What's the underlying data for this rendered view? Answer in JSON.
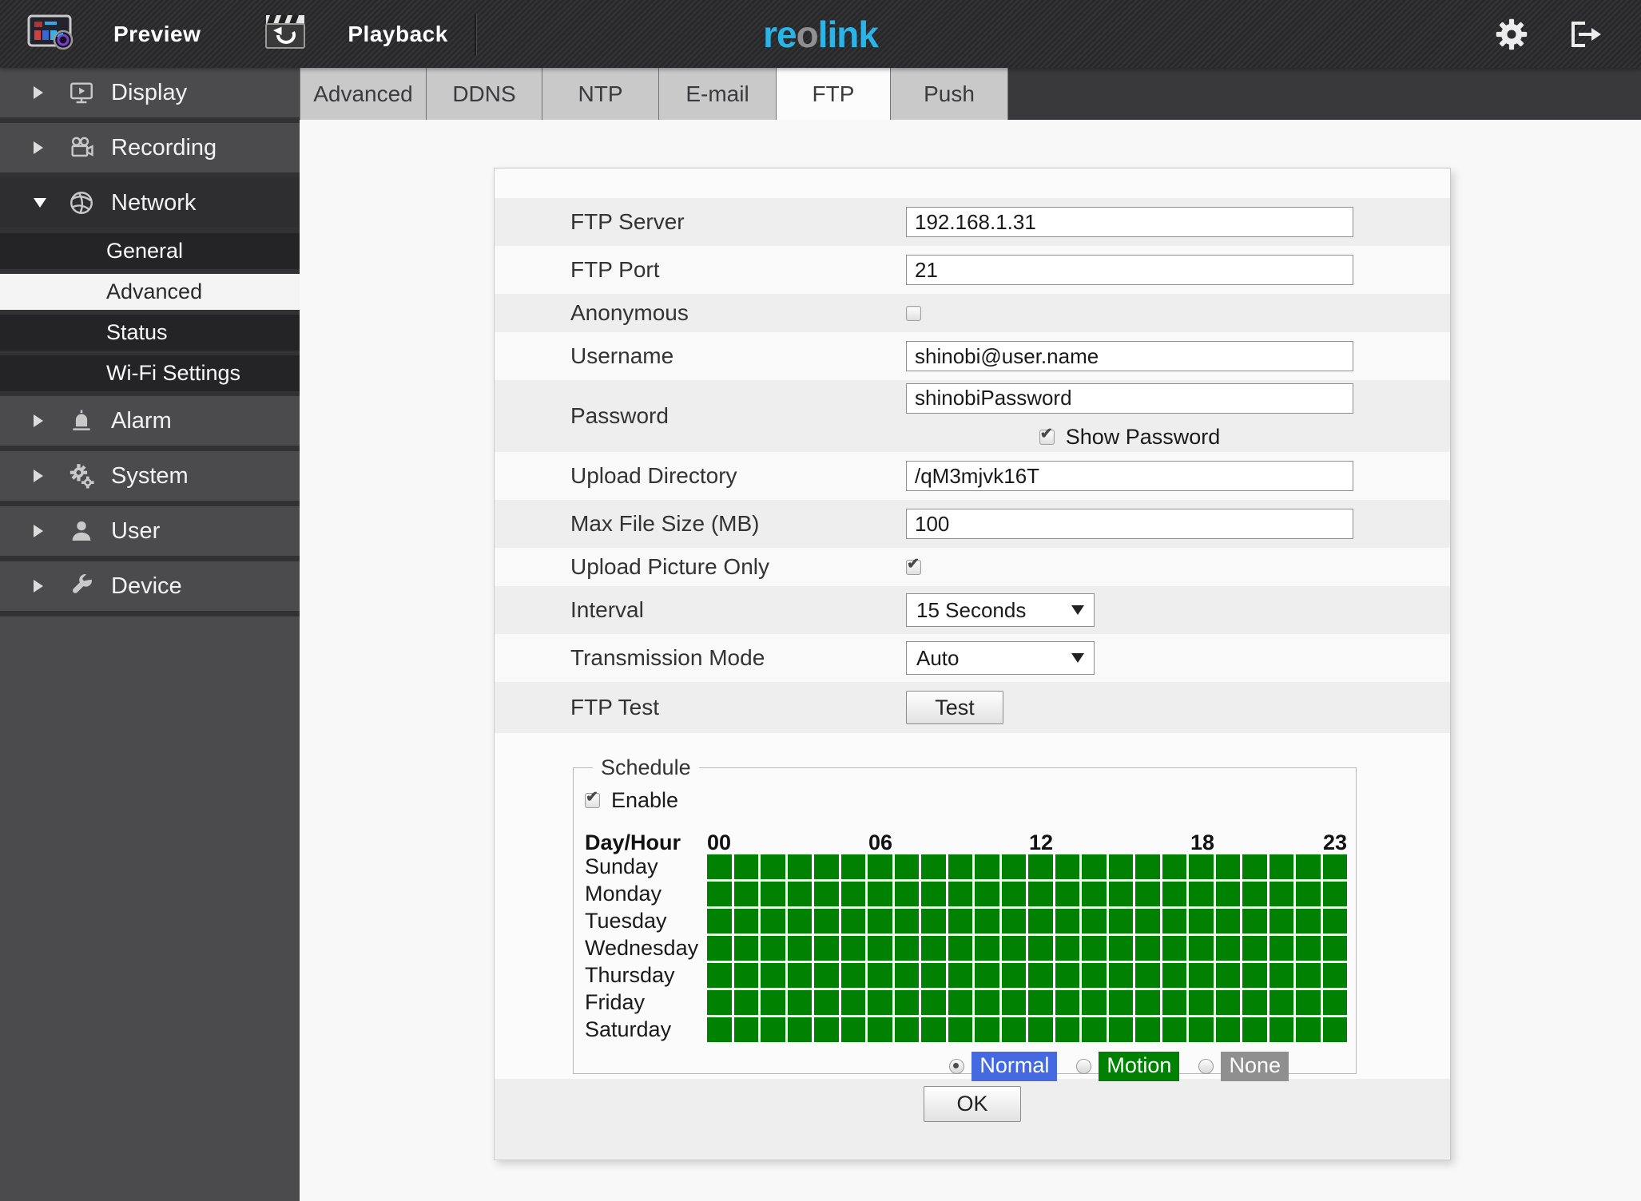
{
  "topbar": {
    "preview_label": "Preview",
    "playback_label": "Playback",
    "logo": {
      "part1": "re",
      "part2": "o",
      "part3": "link",
      "accent_color": "#2ab5e9",
      "o_color": "#8f8f8f"
    },
    "icons": {
      "settings": "gear-icon",
      "logout": "logout-icon"
    }
  },
  "sidebar": {
    "items": [
      {
        "label": "Display",
        "icon": "display-icon",
        "state": "collapsed"
      },
      {
        "label": "Recording",
        "icon": "recording-icon",
        "state": "collapsed"
      },
      {
        "label": "Network",
        "icon": "network-icon",
        "state": "expanded",
        "children": [
          {
            "label": "General",
            "active": false
          },
          {
            "label": "Advanced",
            "active": true
          },
          {
            "label": "Status",
            "active": false
          },
          {
            "label": "Wi-Fi Settings",
            "active": false
          }
        ]
      },
      {
        "label": "Alarm",
        "icon": "alarm-icon",
        "state": "collapsed"
      },
      {
        "label": "System",
        "icon": "system-icon",
        "state": "collapsed"
      },
      {
        "label": "User",
        "icon": "user-icon",
        "state": "collapsed"
      },
      {
        "label": "Device",
        "icon": "device-icon",
        "state": "collapsed"
      }
    ]
  },
  "tabs": {
    "items": [
      {
        "label": "Advanced",
        "active": false
      },
      {
        "label": "DDNS",
        "active": false
      },
      {
        "label": "NTP",
        "active": false
      },
      {
        "label": "E-mail",
        "active": false
      },
      {
        "label": "FTP",
        "active": true
      },
      {
        "label": "Push",
        "active": false
      }
    ]
  },
  "form": {
    "ftp_server": {
      "label": "FTP Server",
      "value": "192.168.1.31"
    },
    "ftp_port": {
      "label": "FTP Port",
      "value": "21"
    },
    "anonymous": {
      "label": "Anonymous",
      "checked": false
    },
    "username": {
      "label": "Username",
      "value": "shinobi@user.name"
    },
    "password": {
      "label": "Password",
      "value": "shinobiPassword",
      "show_password_label": "Show Password",
      "show_password_checked": true
    },
    "upload_directory": {
      "label": "Upload Directory",
      "value": "/qM3mjvk16T"
    },
    "max_file_size": {
      "label": "Max File Size (MB)",
      "value": "100"
    },
    "upload_picture_only": {
      "label": "Upload Picture Only",
      "checked": true
    },
    "interval": {
      "label": "Interval",
      "value": "15 Seconds"
    },
    "transmission_mode": {
      "label": "Transmission Mode",
      "value": "Auto"
    },
    "ftp_test": {
      "label": "FTP Test",
      "button_label": "Test"
    }
  },
  "schedule": {
    "legend": "Schedule",
    "enable_label": "Enable",
    "enabled": true,
    "day_hour_label": "Day/Hour",
    "hour_labels": [
      "00",
      "06",
      "12",
      "18",
      "23"
    ],
    "days": [
      "Sunday",
      "Monday",
      "Tuesday",
      "Wednesday",
      "Thursday",
      "Friday",
      "Saturday"
    ],
    "grid": {
      "rows": 7,
      "cols": 24,
      "all_cells": "motion"
    },
    "cell_color": "#018101",
    "modes": [
      {
        "label": "Normal",
        "color": "#4569e0",
        "selected": true
      },
      {
        "label": "Motion",
        "color": "#018101",
        "selected": false
      },
      {
        "label": "None",
        "color": "#8f8f8f",
        "selected": false
      }
    ]
  },
  "ok_button_label": "OK"
}
